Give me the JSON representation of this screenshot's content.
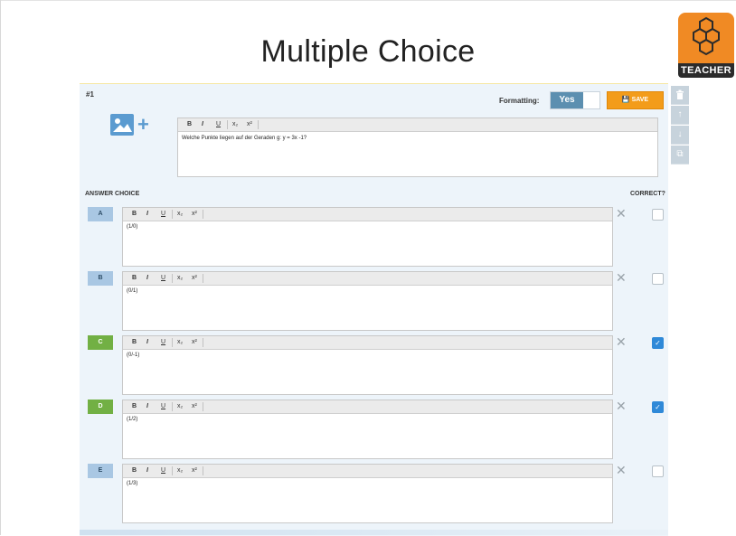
{
  "title": "Multiple Choice",
  "teacher_badge": {
    "label": "TEACHER",
    "icon": "honeycomb-icon"
  },
  "question": {
    "number": "#1",
    "formatting_label": "Formatting:",
    "formatting_value": "Yes",
    "save_label": "SAVE",
    "prompt": "Welche Punkte liegen auf der Geraden g: y = 3x -1?"
  },
  "toolbar": {
    "bold": "B",
    "italic": "I",
    "underline": "U",
    "subscript": "x₂",
    "superscript": "x²"
  },
  "answers_header": {
    "choice": "ANSWER CHOICE",
    "correct": "CORRECT?"
  },
  "answers": [
    {
      "letter": "A",
      "text": "(1/0)",
      "correct": false,
      "color": "#a9c7e3"
    },
    {
      "letter": "B",
      "text": "(0/1)",
      "correct": false,
      "color": "#a9c7e3"
    },
    {
      "letter": "C",
      "text": "(0/-1)",
      "correct": true,
      "color": "#72b044"
    },
    {
      "letter": "D",
      "text": "(1/2)",
      "correct": true,
      "color": "#72b044"
    },
    {
      "letter": "E",
      "text": "(1/3)",
      "correct": false,
      "color": "#a9c7e3"
    }
  ],
  "side_actions": [
    "trash-icon",
    "arrow-up-icon",
    "arrow-down-icon",
    "copy-icon"
  ],
  "colors": {
    "accent": "#f39c1a",
    "toggle_on": "#5c8fb0",
    "checked": "#2f89d8",
    "panel": "#edf4fa"
  }
}
